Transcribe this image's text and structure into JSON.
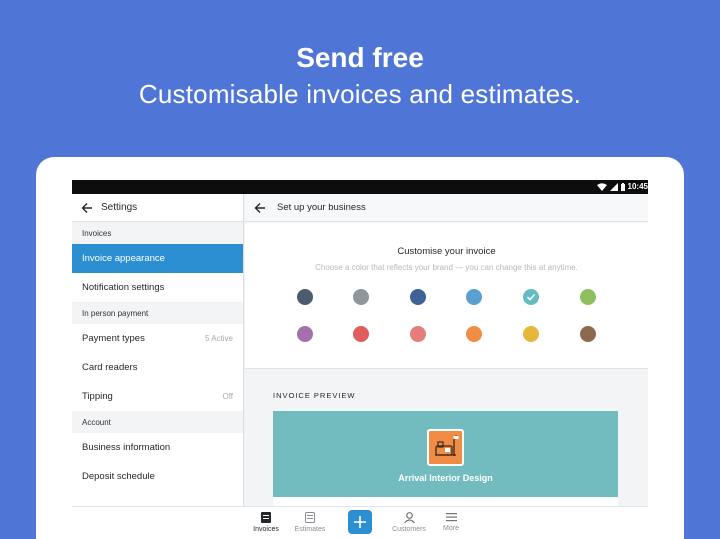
{
  "promo": {
    "headline": "Send free",
    "subline": "Customisable invoices and estimates."
  },
  "statusbar": {
    "time": "10:45"
  },
  "settings": {
    "title": "Settings",
    "sections": [
      {
        "label": "Invoices",
        "items": [
          {
            "label": "Invoice appearance",
            "meta": "",
            "active": true
          },
          {
            "label": "Notification settings",
            "meta": ""
          }
        ]
      },
      {
        "label": "In person payment",
        "items": [
          {
            "label": "Payment types",
            "meta": "5 Active"
          },
          {
            "label": "Card readers",
            "meta": ""
          },
          {
            "label": "Tipping",
            "meta": "Off"
          }
        ]
      },
      {
        "label": "Account",
        "items": [
          {
            "label": "Business information",
            "meta": ""
          },
          {
            "label": "Deposit schedule",
            "meta": ""
          }
        ]
      }
    ]
  },
  "business": {
    "title": "Set up your business",
    "customise_title": "Customise your invoice",
    "customise_sub": "Choose a color that reflects your brand — you can change this at anytime.",
    "colors": [
      "#4d5b6e",
      "#8f969c",
      "#3e6296",
      "#5b9fd1",
      "#62bcc4",
      "#8fbf5e",
      "#a76eb0",
      "#df5d5a",
      "#e57d7d",
      "#f08c44",
      "#e7b63c",
      "#8c6a51"
    ],
    "selected_color_index": 4,
    "preview_label": "INVOICE PREVIEW",
    "preview_business_name": "Arrival Interior Design",
    "preview_color": "#72bcc0"
  },
  "bottomnav": {
    "items": [
      {
        "label": "Invoices",
        "icon": "invoices-icon",
        "active": true
      },
      {
        "label": "Estimates",
        "icon": "estimates-icon"
      },
      {
        "label": "Customers",
        "icon": "customers-icon"
      },
      {
        "label": "More",
        "icon": "more-icon"
      }
    ]
  },
  "accent": "#2c8fd1"
}
